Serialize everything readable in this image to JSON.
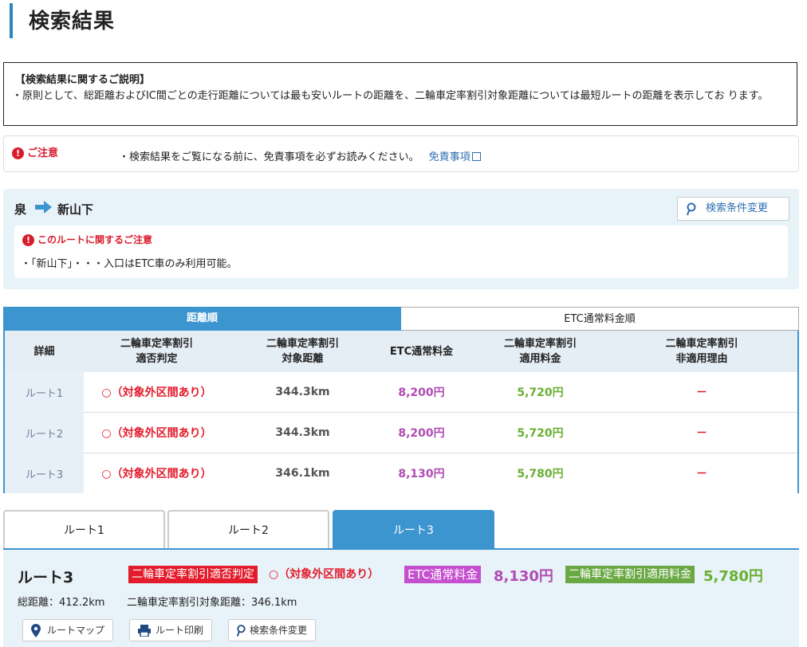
{
  "page_title": "検索結果",
  "explanation": {
    "heading": "【検索結果に関するご説明】",
    "body": "・原則として、総距離およびIC間ごとの走行距離については最も安いルートの距離を、二輪車定率割引対象距離については最短ルートの距離を表示してお ります。"
  },
  "caution": {
    "label": "ご注意",
    "text": "・検索結果をご覧になる前に、免責事項を必ずお読みください。",
    "link": "免責事項"
  },
  "route": {
    "from": "泉",
    "to": "新山下",
    "change_button": "検索条件変更",
    "note_heading": "このルートに関するご注意",
    "note_body": "・「新山下」・・・入口はETC車のみ利用可能。"
  },
  "sort_tabs": [
    "距離順",
    "ETC通常料金順"
  ],
  "table": {
    "headers": [
      [
        "詳細"
      ],
      [
        "二輪車定率割引",
        "適否判定"
      ],
      [
        "二輪車定率割引",
        "対象距離"
      ],
      [
        "ETC通常料金"
      ],
      [
        "二輪車定率割引",
        "適用料金"
      ],
      [
        "二輪車定率割引",
        "非適用理由"
      ]
    ],
    "rows": [
      {
        "name": "ルート1",
        "judge": "○（対象外区間あり）",
        "distance": "344.3km",
        "etc": "8,200円",
        "discount": "5,720円",
        "reason": "－"
      },
      {
        "name": "ルート2",
        "judge": "○（対象外区間あり）",
        "distance": "344.3km",
        "etc": "8,200円",
        "discount": "5,720円",
        "reason": "－"
      },
      {
        "name": "ルート3",
        "judge": "○（対象外区間あり）",
        "distance": "346.1km",
        "etc": "8,130円",
        "discount": "5,780円",
        "reason": "－"
      }
    ]
  },
  "route_tabs": [
    "ルート1",
    "ルート2",
    "ルート3"
  ],
  "detail": {
    "title": "ルート3",
    "judge_tag": "二輪車定率割引適否判定",
    "judge_value": "○（対象外区間あり）",
    "etc_tag": "ETC通常料金",
    "etc_value": "8,130円",
    "two_tag": "二輪車定率割引適用料金",
    "two_value": "5,780円",
    "total_distance": "総距離：412.2km",
    "target_distance": "二輪車定率割引対象距離：346.1km",
    "buttons": [
      "ルートマップ",
      "ルート印刷",
      "検索条件変更"
    ]
  },
  "colors": {
    "accent": "#3d95d0",
    "alert": "#e31b2b",
    "etc": "#b14cb4",
    "discount": "#6ab033"
  }
}
